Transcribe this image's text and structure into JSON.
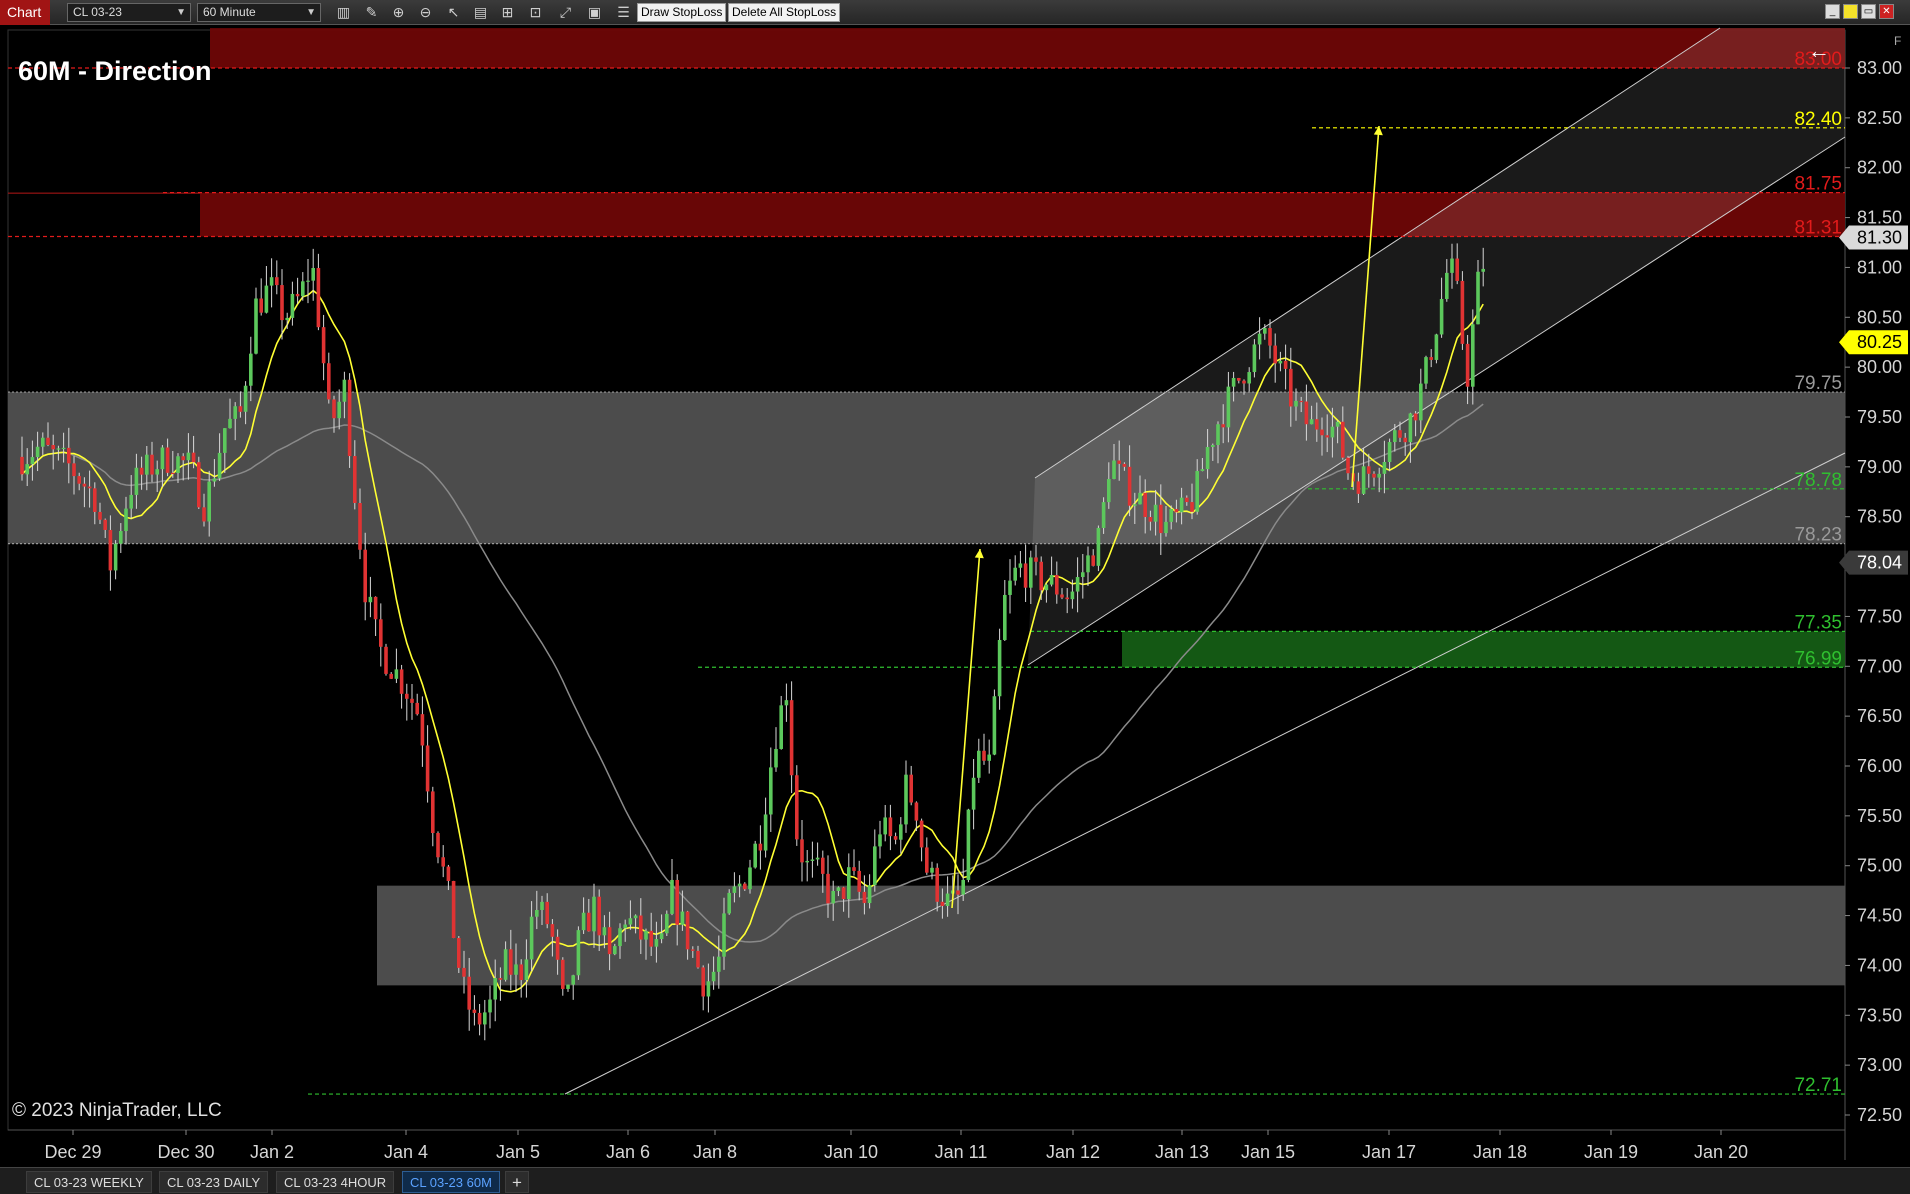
{
  "toolbar": {
    "chart_tab": "Chart",
    "instrument": "CL 03-23",
    "interval": "60 Minute",
    "draw_stoploss": "Draw StopLoss",
    "delete_stoploss": "Delete All StopLoss",
    "icons": [
      "bar-type-icon",
      "pencil-icon",
      "zoom-in-icon",
      "zoom-out-icon",
      "cursor-icon",
      "data-box-icon",
      "properties-icon",
      "strategy-icon",
      "indicator-icon",
      "template-icon",
      "list-icon"
    ],
    "window_controls": [
      "minimize",
      "link",
      "restore",
      "close"
    ]
  },
  "chart": {
    "title": "60M - Direction",
    "copyright": "© 2023 NinjaTrader, LLC",
    "f_marker": "F",
    "back_arrow": "←"
  },
  "tabs": [
    {
      "label": "CL 03-23 WEEKLY",
      "active": false
    },
    {
      "label": "CL 03-23 DAILY",
      "active": false
    },
    {
      "label": "CL 03-23 4HOUR",
      "active": false
    },
    {
      "label": "CL 03-23 60M",
      "active": true
    },
    {
      "label": "+",
      "active": false
    }
  ],
  "chart_data": {
    "type": "candlestick",
    "title": "60M - Direction",
    "ylim": [
      72.25,
      83.2
    ],
    "y_ticks": [
      "83.00",
      "82.50",
      "82.00",
      "81.50",
      "81.00",
      "80.50",
      "80.00",
      "79.50",
      "79.00",
      "78.50",
      "78.00",
      "77.50",
      "77.00",
      "76.50",
      "76.00",
      "75.50",
      "75.00",
      "74.50",
      "74.00",
      "73.50",
      "73.00",
      "72.50"
    ],
    "x_ticks": [
      "Dec 29",
      "Dec 30",
      "Jan 2",
      "Jan 4",
      "Jan 5",
      "Jan 6",
      "Jan 8",
      "Jan 10",
      "Jan 11",
      "Jan 12",
      "Jan 13",
      "Jan 15",
      "Jan 17",
      "Jan 18",
      "Jan 19",
      "Jan 20"
    ],
    "current_price": "81.30",
    "sma_value": "80.25",
    "slow_ma_value": "78.04",
    "levels": [
      {
        "price": 83.0,
        "label": "83.00",
        "color": "#e21b1b"
      },
      {
        "price": 82.4,
        "label": "82.40",
        "color": "#ffff00"
      },
      {
        "price": 81.75,
        "label": "81.75",
        "color": "#e21b1b"
      },
      {
        "price": 81.31,
        "label": "81.31",
        "color": "#e21b1b"
      },
      {
        "price": 79.75,
        "label": "79.75",
        "color": "#9a9a9a"
      },
      {
        "price": 78.78,
        "label": "78.78",
        "color": "#2fbf2f"
      },
      {
        "price": 78.23,
        "label": "78.23",
        "color": "#9a9a9a"
      },
      {
        "price": 77.35,
        "label": "77.35",
        "color": "#2fbf2f"
      },
      {
        "price": 76.99,
        "label": "76.99",
        "color": "#2fbf2f"
      },
      {
        "price": 72.71,
        "label": "72.71",
        "color": "#2fbf2f"
      }
    ],
    "zones": [
      {
        "from": 83.0,
        "to": 83.4,
        "color": "#6e0606"
      },
      {
        "from": 81.31,
        "to": 81.75,
        "color": "#6e0606"
      },
      {
        "from": 78.23,
        "to": 79.75,
        "color": "#505050"
      },
      {
        "from": 76.99,
        "to": 77.35,
        "color": "#155d15"
      },
      {
        "from": 73.8,
        "to": 74.8,
        "color": "#505050"
      }
    ],
    "colors": {
      "up": "#5cc85c",
      "down": "#e03333",
      "fast_ma": "#ffff33",
      "slow_ma": "#8a8a8a",
      "background": "#000000"
    }
  }
}
